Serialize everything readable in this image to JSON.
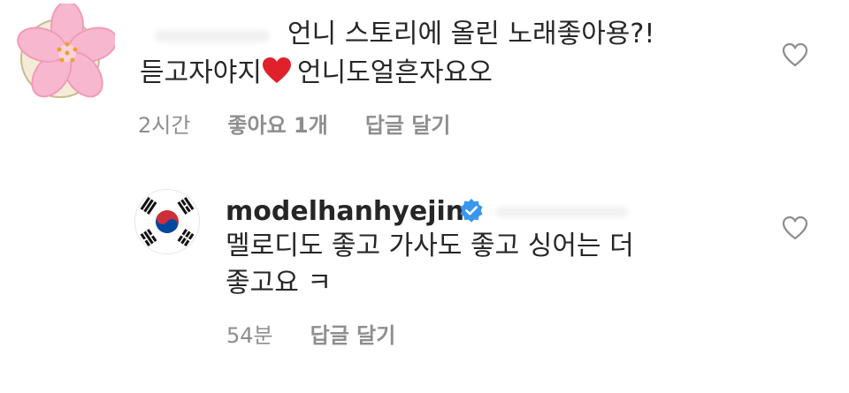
{
  "comments": [
    {
      "avatar_icon": "cherry-blossom-icon",
      "line1": "언니 스토리에 올린 노래좋아용?!",
      "line2": "듣고자야지",
      "emoji": "red-heart-icon",
      "line2_tail": "언니도얼흔자요오",
      "time": "2시간",
      "likes": "좋아요 1개",
      "reply": "답글 달기"
    },
    {
      "avatar_icon": "korean-flag-icon",
      "username": "modelhanhyejin",
      "badge": "verified-icon",
      "line1": "멜로디도 좋고 가사도 좋고 싱어는 더",
      "line2": "좋고요 ㅋ",
      "time": "54분",
      "reply": "답글 달기"
    }
  ],
  "colors": {
    "text": "#262626",
    "meta": "#8e8e8e",
    "verified": "#3897f0",
    "heart_emoji": "#e0202a"
  }
}
